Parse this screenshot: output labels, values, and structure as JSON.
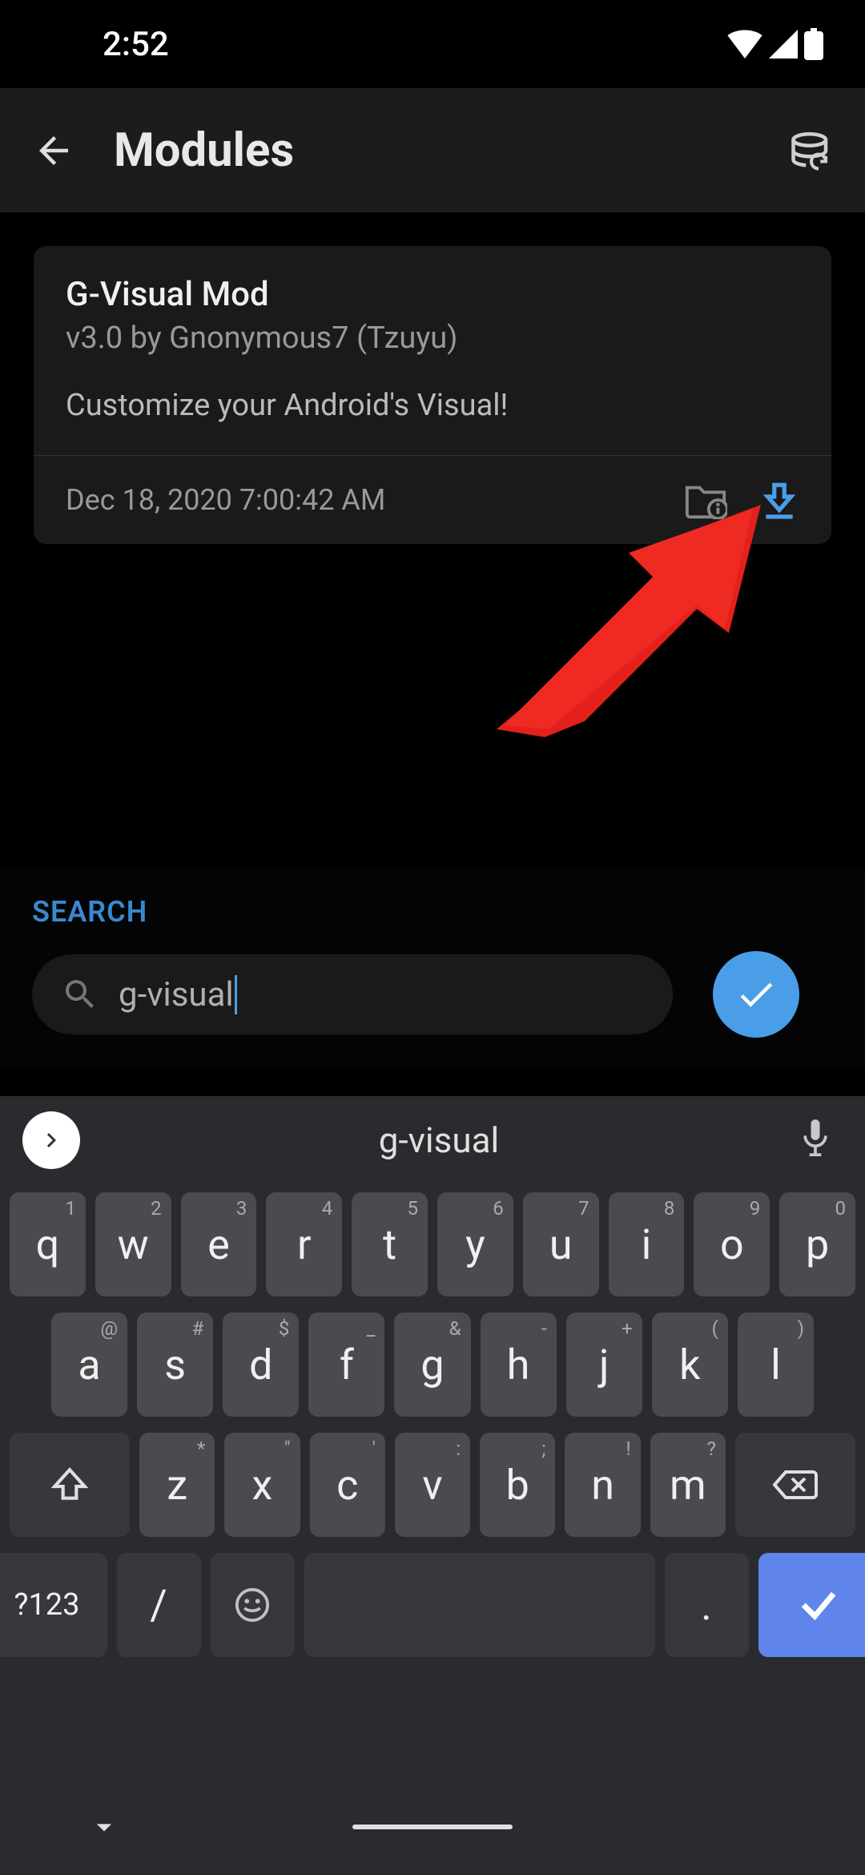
{
  "status": {
    "time": "2:52"
  },
  "app_bar": {
    "title": "Modules"
  },
  "module": {
    "title": "G-Visual Mod",
    "meta": "v3.0 by Gnonymous7 (Tzuyu)",
    "description": "Customize your Android's Visual!",
    "date": "Dec 18, 2020 7:00:42 AM"
  },
  "search": {
    "label": "SEARCH",
    "value": "g-visual"
  },
  "keyboard": {
    "suggestion": "g-visual",
    "row1": [
      {
        "k": "q",
        "s": "1"
      },
      {
        "k": "w",
        "s": "2"
      },
      {
        "k": "e",
        "s": "3"
      },
      {
        "k": "r",
        "s": "4"
      },
      {
        "k": "t",
        "s": "5"
      },
      {
        "k": "y",
        "s": "6"
      },
      {
        "k": "u",
        "s": "7"
      },
      {
        "k": "i",
        "s": "8"
      },
      {
        "k": "o",
        "s": "9"
      },
      {
        "k": "p",
        "s": "0"
      }
    ],
    "row2": [
      {
        "k": "a",
        "s": "@"
      },
      {
        "k": "s",
        "s": "#"
      },
      {
        "k": "d",
        "s": "$"
      },
      {
        "k": "f",
        "s": "_"
      },
      {
        "k": "g",
        "s": "&"
      },
      {
        "k": "h",
        "s": "-"
      },
      {
        "k": "j",
        "s": "+"
      },
      {
        "k": "k",
        "s": "("
      },
      {
        "k": "l",
        "s": ")"
      }
    ],
    "row3": [
      {
        "k": "z",
        "s": "*"
      },
      {
        "k": "x",
        "s": "\""
      },
      {
        "k": "c",
        "s": "'"
      },
      {
        "k": "v",
        "s": ":"
      },
      {
        "k": "b",
        "s": ";"
      },
      {
        "k": "n",
        "s": "!"
      },
      {
        "k": "m",
        "s": "?"
      }
    ],
    "symbols_key": "?123",
    "slash_key": "/",
    "period_key": "."
  }
}
